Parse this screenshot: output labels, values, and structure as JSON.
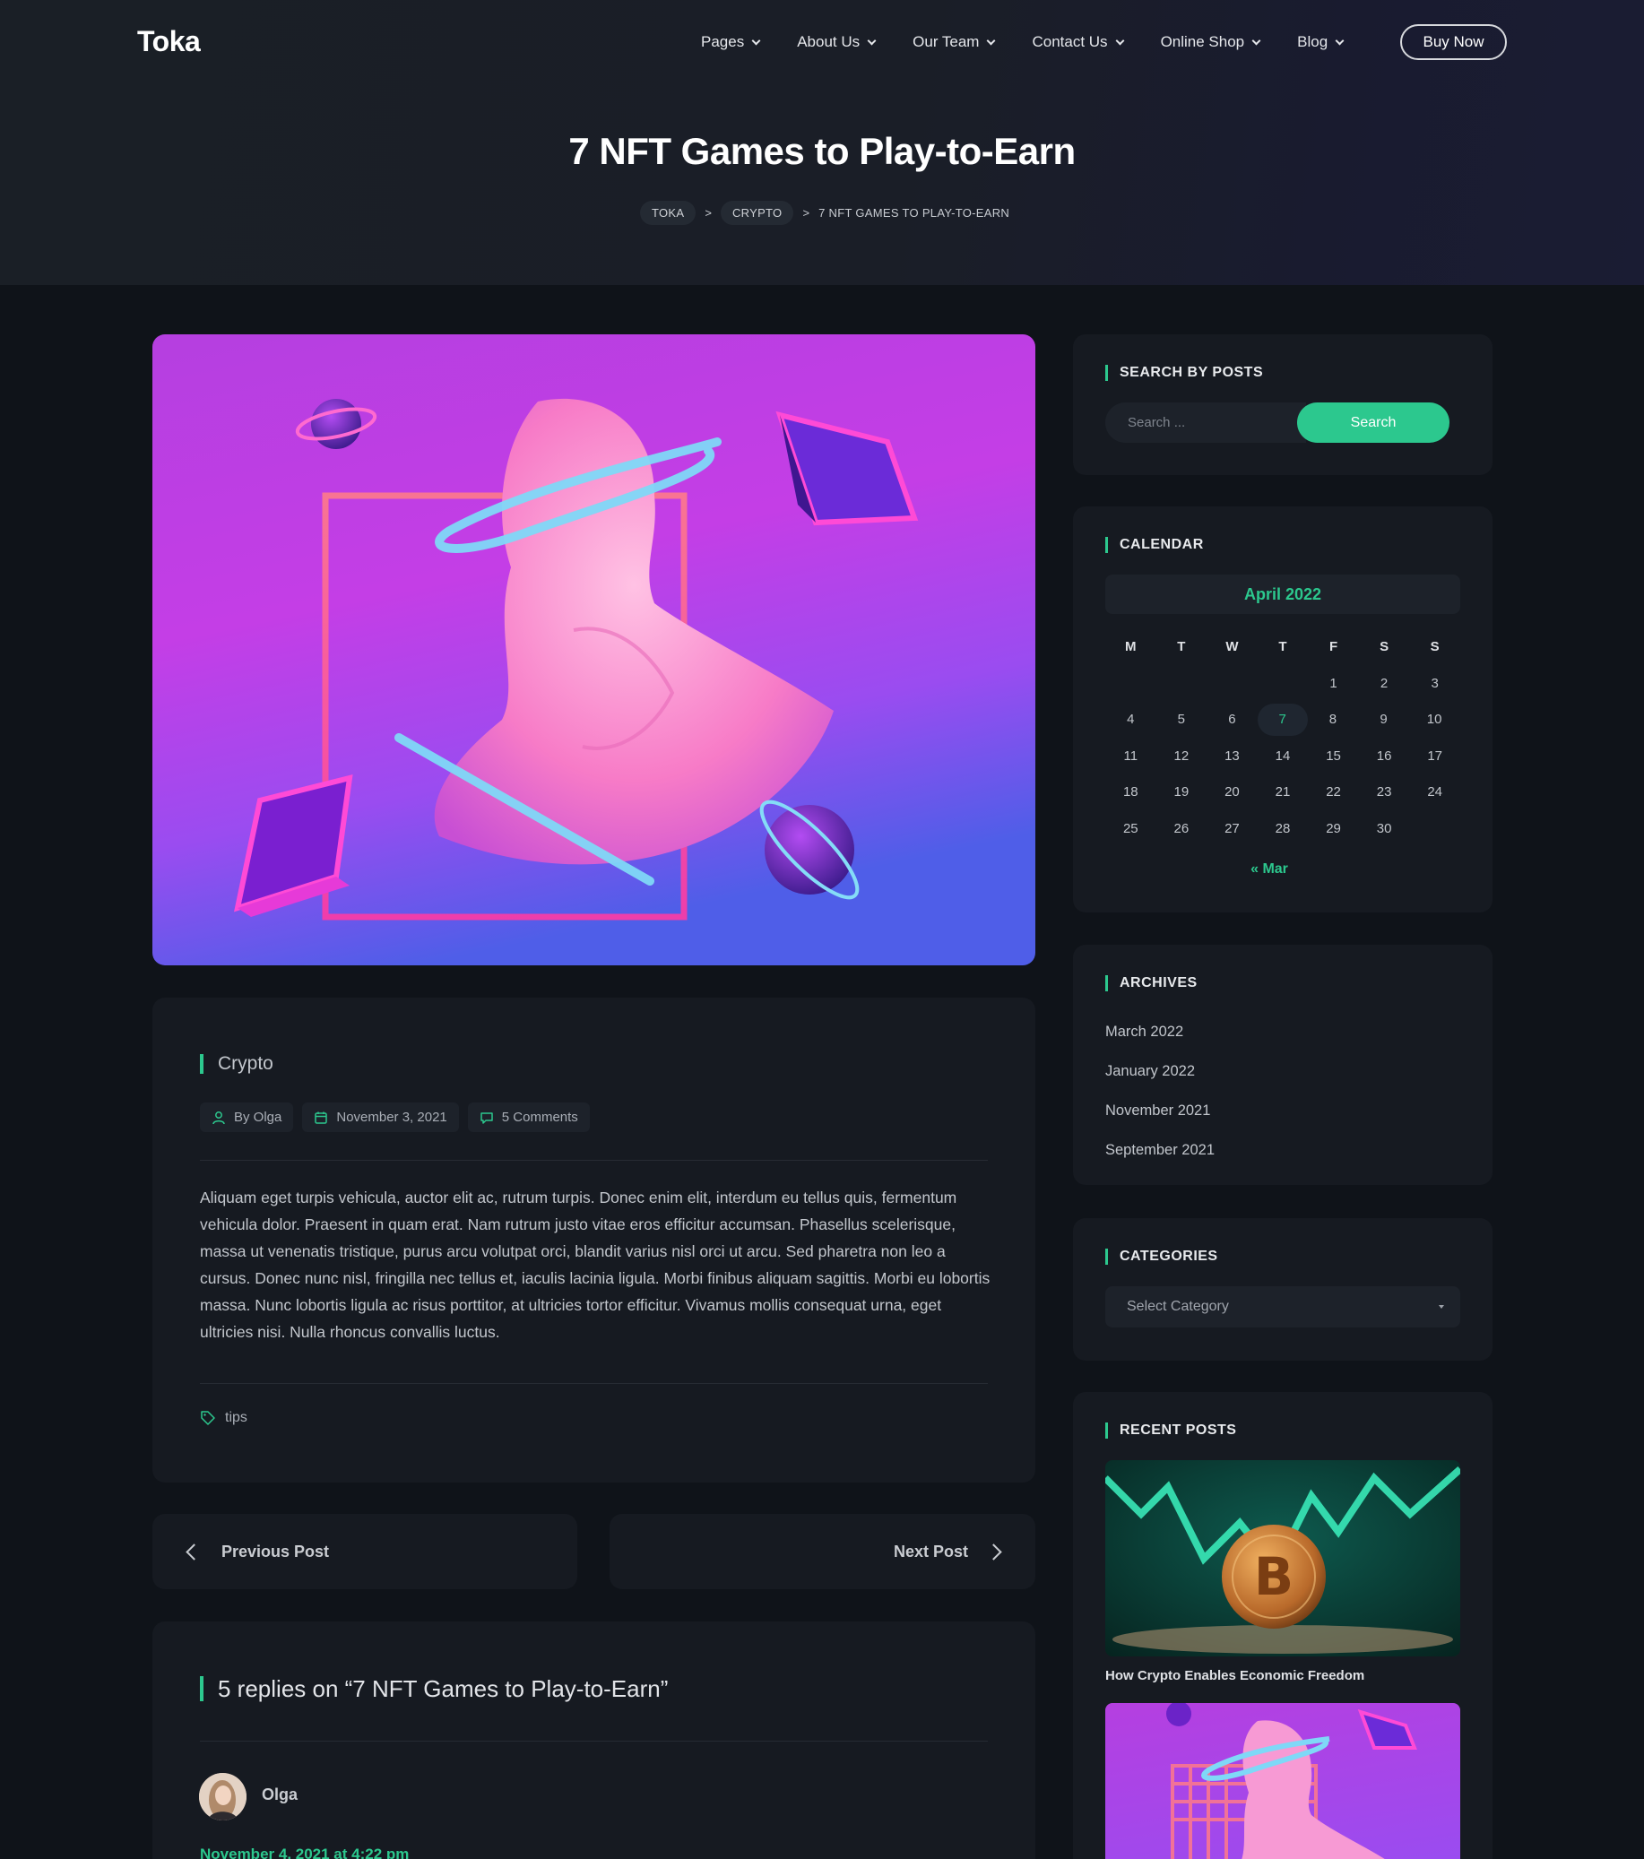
{
  "header": {
    "logo": "Toka",
    "nav": [
      "Pages",
      "About Us",
      "Our Team",
      "Contact Us",
      "Online Shop",
      "Blog"
    ],
    "buy_label": "Buy Now",
    "title": "7 NFT Games to Play-to-Earn",
    "breadcrumb": [
      "TOKA",
      "CRYPTO",
      "7 NFT GAMES TO PLAY-TO-EARN"
    ],
    "breadcrumb_sep": ">"
  },
  "post": {
    "category": "Crypto",
    "author": "By Olga",
    "date": "November 3, 2021",
    "comments": "5 Comments",
    "body": "Aliquam eget turpis vehicula, auctor elit ac, rutrum turpis. Donec enim elit, interdum eu tellus quis, fermentum vehicula dolor. Praesent in quam erat. Nam rutrum justo vitae eros efficitur accumsan. Phasellus scelerisque, massa ut venenatis tristique, purus arcu volutpat orci, blandit varius nisl orci ut arcu. Sed pharetra non leo a cursus. Donec nunc nisl, fringilla nec tellus et, iaculis lacinia ligula. Morbi finibus aliquam sagittis. Morbi eu lobortis massa. Nunc lobortis ligula ac risus porttitor, at ultricies tortor efficitur. Vivamus mollis consequat urna, eget ultricies nisi. Nulla rhoncus convallis luctus.",
    "tag": "tips"
  },
  "post_nav": {
    "prev": "Previous Post",
    "next": "Next Post"
  },
  "comments_section": {
    "title": "5 replies on “7 NFT Games to Play-to-Earn”",
    "first_author": "Olga",
    "first_date": "November 4, 2021 at 4:22 pm"
  },
  "sidebar": {
    "search": {
      "title": "SEARCH BY POSTS",
      "placeholder": "Search ...",
      "button": "Search"
    },
    "calendar": {
      "title": "CALENDAR",
      "month": "April 2022",
      "weekdays": [
        "M",
        "T",
        "W",
        "T",
        "F",
        "S",
        "S"
      ],
      "weeks": [
        [
          "",
          "",
          "",
          "",
          "1",
          "2",
          "3"
        ],
        [
          "4",
          "5",
          "6",
          "7",
          "8",
          "9",
          "10"
        ],
        [
          "11",
          "12",
          "13",
          "14",
          "15",
          "16",
          "17"
        ],
        [
          "18",
          "19",
          "20",
          "21",
          "22",
          "23",
          "24"
        ],
        [
          "25",
          "26",
          "27",
          "28",
          "29",
          "30",
          ""
        ]
      ],
      "today": "7",
      "prev_link": "« Mar"
    },
    "archives": {
      "title": "ARCHIVES",
      "items": [
        "March 2022",
        "January 2022",
        "November 2021",
        "September 2021"
      ]
    },
    "categories": {
      "title": "CATEGORIES",
      "select": "Select Category"
    },
    "recent": {
      "title": "RECENT POSTS",
      "posts": [
        "How Crypto Enables Economic Freedom"
      ]
    }
  },
  "colors": {
    "accent": "#2cc88e",
    "background": "#0f1319",
    "card": "#161a21"
  }
}
